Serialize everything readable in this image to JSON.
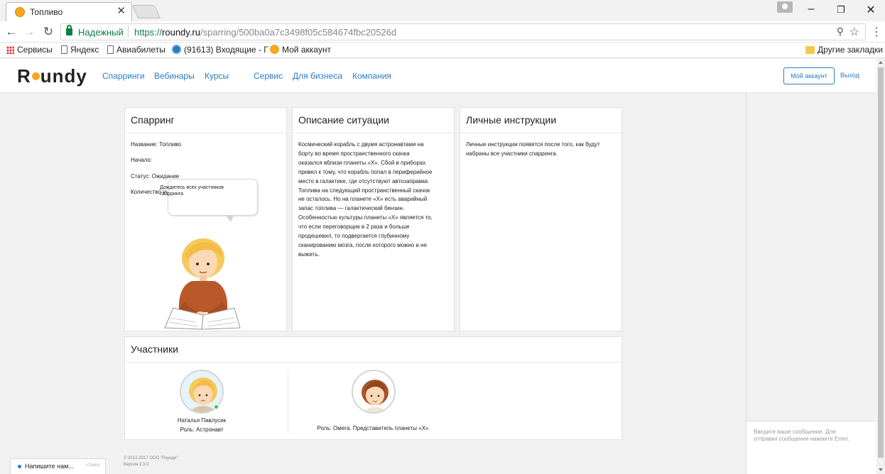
{
  "browser": {
    "tab_title": "Топливо",
    "tab_close": "✕",
    "window_controls": {
      "minimize": "–",
      "restore": "❐",
      "close": "✕"
    },
    "nav": {
      "back": "←",
      "forward": "→",
      "reload": "↻"
    },
    "secure_label": "Надежный",
    "url_scheme": "https://",
    "url_domain": "roundy.ru",
    "url_path": "/sparring/500ba0a7c3498f05c584674fbc20526d",
    "zoom_icon": "⚲",
    "star_icon": "☆",
    "menu_icon": "⋮",
    "bookmarks": [
      {
        "label": "Сервисы",
        "icon": "apps-icon"
      },
      {
        "label": "Яндекс",
        "icon": "page-icon"
      },
      {
        "label": "Авиабилеты",
        "icon": "page-icon"
      },
      {
        "label": "(91613) Входящие - Г",
        "icon": "blue-circle-icon"
      },
      {
        "label": "Мой аккаунт",
        "icon": "orange-icon"
      }
    ],
    "other_bookmarks": "Другие закладки"
  },
  "site": {
    "logo_start": "R",
    "logo_end": "undy",
    "nav": [
      "Спарринги",
      "Вебинары",
      "Курсы",
      "Сервис",
      "Для бизнеса",
      "Компания"
    ],
    "account_button": "Мой аккаунт",
    "logout": "Выход",
    "colors": {
      "link": "#2a7cc7",
      "accent": "#f6a623"
    }
  },
  "sparring": {
    "heading": "Спарринг",
    "name": "Название: Топливо",
    "start": "Начало:",
    "status": "Статус: Ожидание",
    "participants_count": "Количество участников: 2",
    "bubble": "Дождитесь всех участников спарринга"
  },
  "situation": {
    "heading": "Описание ситуации",
    "lines": [
      "Космический корабль с двумя астронавтами на",
      "борту во время пространственного скачка",
      "оказался вблизи планеты «Х». Сбой в приборах",
      "привел к тому, что корабль попал в периферийное",
      "место в галактике, где отсутствуют автозаправки.",
      "Топлива на следующий пространственный скачок",
      "не осталось.  Но на планете «Х» есть аварийный",
      "запас топлива — галактический бензин.",
      "Особенностью культуры планеты «Х» является то,",
      "что если переговорщик в 2 раза и больше",
      "продешевил, то подвергается глубинному",
      "сканированию мозга, после которого можно и не",
      "выжить."
    ]
  },
  "instructions": {
    "heading": "Личные инструкции",
    "lines": [
      "Личные инструкции появятся после того, как будут",
      "набраны все участники спарринга."
    ]
  },
  "participants": {
    "heading": "Участники",
    "list": [
      {
        "name": "Наталья Павлусик",
        "role": "Роль: Астронавт",
        "online": true
      },
      {
        "name": "",
        "role": "Роль: Омега. Представитель планеты «Х»",
        "online": false
      }
    ]
  },
  "chat": {
    "placeholder_lines": [
      "Введите ваше сообщение. Для",
      "отправки сообщения нажмите Enter."
    ]
  },
  "footer": {
    "copyright": "© 2012-2017 ООО \"Раунди\"",
    "version": "Версия 2.3.0"
  },
  "chatra": {
    "label": "Напишите нам...",
    "brand": "~Chatra"
  }
}
